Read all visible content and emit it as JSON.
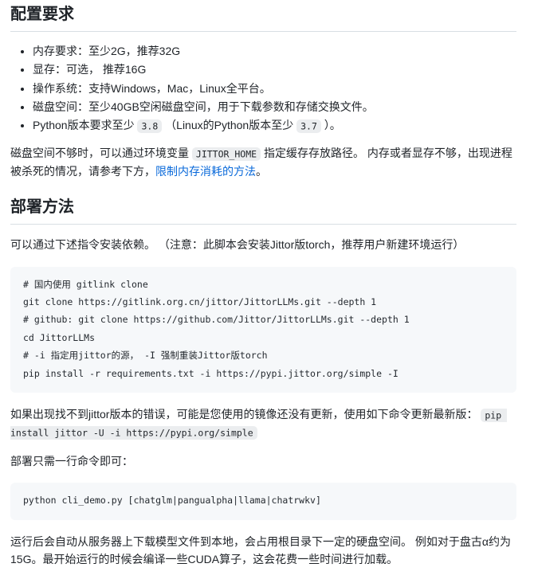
{
  "appearance": {
    "text_color": "#1f2328",
    "link_color": "#0969da",
    "code_block_bg": "#f6f8fa",
    "inline_code_bg": "#eff1f3",
    "heading_border": "#d8dee4"
  },
  "requirements": {
    "heading": "配置要求",
    "bullets": {
      "memory": "内存要求：至少2G，推荐32G",
      "vram": "显存：可选， 推荐16G",
      "os": "操作系统：支持Windows，Mac，Linux全平台。",
      "disk": "磁盘空间：至少40GB空闲磁盘空间，用于下载参数和存储交换文件。",
      "python": {
        "prefix": "Python版本要求至少",
        "code_min": "3.8",
        "mid": "（Linux的Python版本至少",
        "code_linux": "3.7",
        "suffix": "）。"
      }
    },
    "note": {
      "part1": "磁盘空间不够时，可以通过环境变量",
      "env_var": "JITTOR_HOME",
      "part2": "指定缓存存放路径。 内存或者显存不够，出现进程被杀死的情况，请参考下方，",
      "link_text": "限制内存消耗的方法",
      "part3": "。"
    }
  },
  "deployment": {
    "heading": "部署方法",
    "intro": "可以通过下述指令安装依赖。 （注意：此脚本会安装Jittor版torch，推荐用户新建环境运行）",
    "install_code": "# 国内使用 gitlink clone\ngit clone https://gitlink.org.cn/jittor/JittorLLMs.git --depth 1\n# github: git clone https://github.com/Jittor/JittorLLMs.git --depth 1\ncd JittorLLMs\n# -i 指定用jittor的源， -I 强制重装Jittor版torch\npip install -r requirements.txt -i https://pypi.jittor.org/simple -I",
    "update_note": {
      "part1": "如果出现找不到jittor版本的错误，可能是您使用的镜像还没有更新，使用如下命令更新最新版：",
      "code": "pip install jittor -U -i https://pypi.org/simple"
    },
    "one_line_note": "部署只需一行命令即可：",
    "run_code": "python cli_demo.py [chatglm|pangualpha|llama|chatrwkv]",
    "download_note": "运行后会自动从服务器上下载模型文件到本地，会占用根目录下一定的硬盘空间。 例如对于盘古α约为 15G。最开始运行的时候会编译一些CUDA算子，这会花费一些时间进行加载。"
  }
}
